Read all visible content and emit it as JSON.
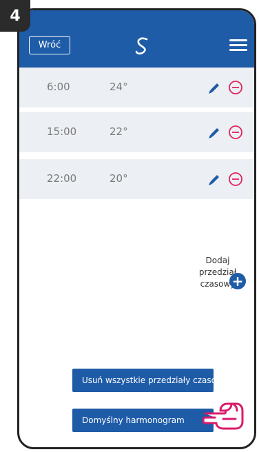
{
  "step": "4",
  "header": {
    "back_label": "Wróć"
  },
  "schedule": [
    {
      "time": "6:00",
      "temp": "24°"
    },
    {
      "time": "15:00",
      "temp": "22°"
    },
    {
      "time": "22:00",
      "temp": "20°"
    }
  ],
  "add_interval": {
    "line1": "Dodaj",
    "line2": "przedział",
    "line3": "czasowy"
  },
  "buttons": {
    "remove_all": "Usuń wszystkie przedziały czasowe",
    "default_schedule": "Domyślny harmonogram"
  },
  "colors": {
    "primary": "#1f5ca8",
    "delete_accent": "#e0245e",
    "row_bg": "#eceff3"
  },
  "icons": [
    "logo-icon",
    "menu-icon",
    "pencil-icon",
    "minus-circle-icon",
    "plus-circle-icon",
    "pointing-hand-icon"
  ]
}
